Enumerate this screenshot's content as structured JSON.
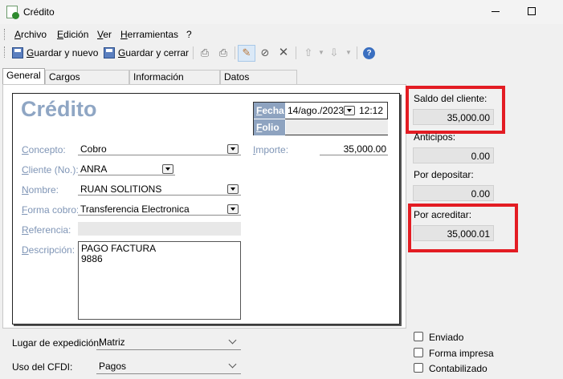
{
  "window": {
    "title": "Crédito"
  },
  "menu": [
    "Archivo",
    "Edición",
    "Ver",
    "Herramientas",
    "?"
  ],
  "toolbar": {
    "save_new": "Guardar y nuevo",
    "save_close": "Guardar y cerrar"
  },
  "tabs": [
    "General",
    "Cargos acreditados",
    "Información bancaria",
    "Datos particulares"
  ],
  "form": {
    "title": "Crédito",
    "fecha_label": "Fecha",
    "fecha_value": "14/ago./2023",
    "hora_value": "12:12",
    "folio_label": "Folio",
    "folio_value": "",
    "concepto_label": "Concepto:",
    "concepto_value": "Cobro",
    "importe_label": "Importe:",
    "importe_value": "35,000.00",
    "cliente_label": "Cliente (No.):",
    "cliente_value": "ANRA",
    "nombre_label": "Nombre:",
    "nombre_value": "RUAN SOLITIONS",
    "forma_label": "Forma cobro:",
    "forma_value": "Transferencia Electronica",
    "referencia_label": "Referencia:",
    "descripcion_label": "Descripción:",
    "descripcion_value": "PAGO FACTURA\n9886"
  },
  "bottom": {
    "lugar_label": "Lugar de expedición:",
    "lugar_value": "Matriz",
    "uso_label": "Uso del CFDI:",
    "uso_value": "Pagos"
  },
  "side": {
    "saldo_label": "Saldo del cliente:",
    "saldo_value": "35,000.00",
    "anticipos_label": "Anticipos:",
    "anticipos_value": "0.00",
    "depositar_label": "Por depositar:",
    "depositar_value": "0.00",
    "acreditar_label": "Por acreditar:",
    "acreditar_value": "35,000.01"
  },
  "checks": [
    "Enviado",
    "Forma impresa",
    "Contabilizado"
  ],
  "colors": {
    "highlight": "#e31c23",
    "label_blue": "#7f95b6",
    "title_blue": "#8fa6c4"
  }
}
